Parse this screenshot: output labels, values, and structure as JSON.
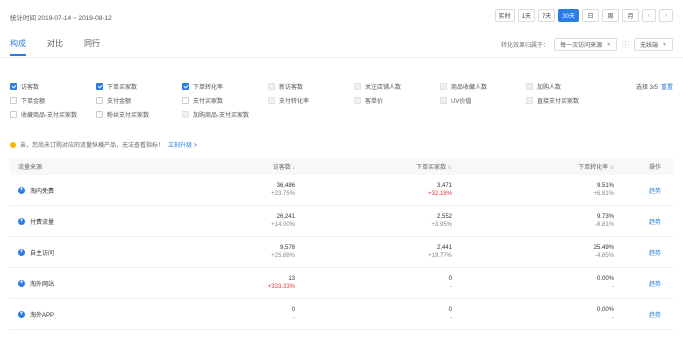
{
  "header": {
    "stat_time": "统计时间 2019-07-14 ~ 2019-08-12",
    "range_buttons": [
      "实时",
      "1天",
      "7天",
      "30天",
      "日",
      "周",
      "月"
    ],
    "active_range": "30天",
    "prev_icon": "chevron-left-icon",
    "next_icon": "chevron-right-icon"
  },
  "tabs": [
    "构成",
    "对比",
    "同行"
  ],
  "active_tab": "构成",
  "conversion": {
    "label": "转化效果归属于：",
    "select_value": "每一次访问来源",
    "wireless_value": "无线端"
  },
  "metrics": [
    {
      "label": "访客数",
      "checked": true
    },
    {
      "label": "下单买家数",
      "checked": true
    },
    {
      "label": "下单转化率",
      "checked": true
    },
    {
      "label": "新访客数",
      "checked": false
    },
    {
      "label": "关注店铺人数",
      "checked": false
    },
    {
      "label": "商品收藏人数",
      "checked": false
    },
    {
      "label": "下单金额",
      "checked": false
    },
    {
      "label": "支付金额",
      "checked": false
    },
    {
      "label": "支付买家数",
      "checked": false
    },
    {
      "label": "支付转化率",
      "checked": false
    },
    {
      "label": "客单价",
      "checked": false
    },
    {
      "label": "UV价值",
      "checked": false
    },
    {
      "label": "收藏商品-支付买家数",
      "checked": false
    },
    {
      "label": "粉丝支付买家数",
      "checked": false
    },
    {
      "label": "加购商品-支付买家数",
      "checked": false
    }
  ],
  "metrics_right": [
    {
      "label": "加购人数",
      "checked": false
    },
    {
      "label": "直接支付买家数",
      "checked": false
    }
  ],
  "pick": {
    "label": "选择 3/5",
    "reset": "重置"
  },
  "tip": {
    "text": "亲，您尚未订购对应的流量纵横产品，无法查看指标！",
    "link": "立刻升级 >"
  },
  "table": {
    "headers": {
      "source": "流量来源",
      "visitors": "访客数",
      "buyers": "下单买家数",
      "rate": "下单转化率",
      "ops": "操作"
    },
    "rows": [
      {
        "source": "淘内免费",
        "visitors": "36,486",
        "visitors_chg": "+23.75%",
        "buyers": "3,471",
        "buyers_chg": "+32.18%",
        "buyers_red": true,
        "rate": "9.51%",
        "rate_chg": "+6.81%",
        "op": "趋势"
      },
      {
        "source": "付费流量",
        "visitors": "26,241",
        "visitors_chg": "+14.00%",
        "buyers": "2,552",
        "buyers_chg": "+3.95%",
        "buyers_red": false,
        "rate": "9.73%",
        "rate_chg": "-8.81%",
        "op": "趋势"
      },
      {
        "source": "自主访问",
        "visitors": "9,578",
        "visitors_chg": "+25.88%",
        "buyers": "2,441",
        "buyers_chg": "+19.77%",
        "buyers_red": false,
        "rate": "25.49%",
        "rate_chg": "-4.85%",
        "op": "趋势"
      },
      {
        "source": "淘外网站",
        "visitors": "13",
        "visitors_chg": "+333.33%",
        "visitors_red": true,
        "buyers": "0",
        "buyers_chg": "-",
        "buyers_red": false,
        "rate": "0.00%",
        "rate_chg": "-",
        "op": "趋势"
      },
      {
        "source": "淘外APP",
        "visitors": "0",
        "visitors_chg": "-",
        "buyers": "0",
        "buyers_chg": "-",
        "buyers_red": false,
        "rate": "0.00%",
        "rate_chg": "-",
        "op": "趋势"
      }
    ]
  },
  "colors": {
    "accent": "#2a7de1",
    "negative": "#e23a3a",
    "tip": "#f5b800"
  }
}
